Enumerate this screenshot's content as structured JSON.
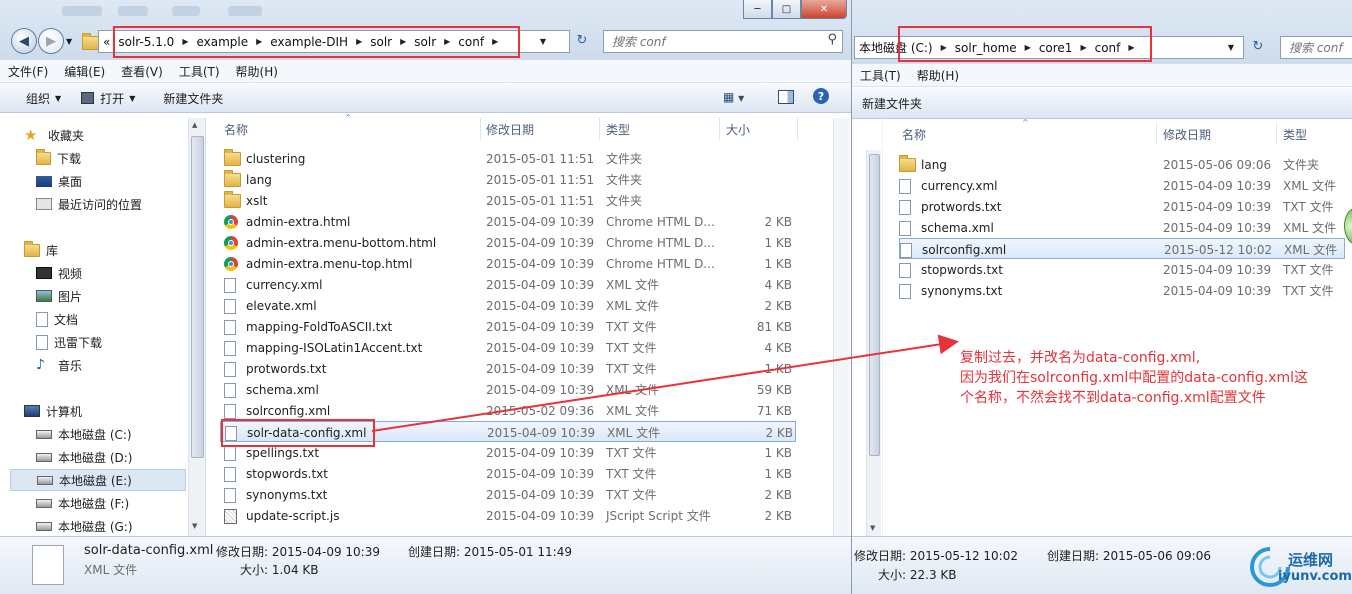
{
  "left": {
    "breadcrumbs": [
      "solr-5.1.0",
      "example",
      "example-DIH",
      "solr",
      "solr",
      "conf"
    ],
    "overflow_chevron": "«",
    "search_placeholder": "搜索 conf",
    "menu": [
      "文件(F)",
      "编辑(E)",
      "查看(V)",
      "工具(T)",
      "帮助(H)"
    ],
    "toolbar": {
      "organize": "组织",
      "open": "打开",
      "new_folder": "新建文件夹"
    },
    "nav": {
      "favorites": "收藏夹",
      "favorites_items": [
        "下载",
        "桌面",
        "最近访问的位置"
      ],
      "libraries": "库",
      "library_items": [
        "视频",
        "图片",
        "文档",
        "迅雷下载",
        "音乐"
      ],
      "computer": "计算机",
      "drives": [
        "本地磁盘 (C:)",
        "本地磁盘 (D:)",
        "本地磁盘 (E:)",
        "本地磁盘 (F:)",
        "本地磁盘 (G:)"
      ]
    },
    "columns": {
      "name": "名称",
      "date": "修改日期",
      "type": "类型",
      "size": "大小"
    },
    "files": [
      {
        "icon": "folder-icon",
        "name": "clustering",
        "date": "2015-05-01 11:51",
        "type": "文件夹",
        "size": ""
      },
      {
        "icon": "folder-icon",
        "name": "lang",
        "date": "2015-05-01 11:51",
        "type": "文件夹",
        "size": ""
      },
      {
        "icon": "folder-icon",
        "name": "xslt",
        "date": "2015-05-01 11:51",
        "type": "文件夹",
        "size": ""
      },
      {
        "icon": "chrome-html-icon",
        "name": "admin-extra.html",
        "date": "2015-04-09 10:39",
        "type": "Chrome HTML D...",
        "size": "2 KB"
      },
      {
        "icon": "chrome-html-icon",
        "name": "admin-extra.menu-bottom.html",
        "date": "2015-04-09 10:39",
        "type": "Chrome HTML D...",
        "size": "1 KB"
      },
      {
        "icon": "chrome-html-icon",
        "name": "admin-extra.menu-top.html",
        "date": "2015-04-09 10:39",
        "type": "Chrome HTML D...",
        "size": "1 KB"
      },
      {
        "icon": "document-icon",
        "name": "currency.xml",
        "date": "2015-04-09 10:39",
        "type": "XML 文件",
        "size": "4 KB"
      },
      {
        "icon": "document-icon",
        "name": "elevate.xml",
        "date": "2015-04-09 10:39",
        "type": "XML 文件",
        "size": "2 KB"
      },
      {
        "icon": "document-icon",
        "name": "mapping-FoldToASCII.txt",
        "date": "2015-04-09 10:39",
        "type": "TXT 文件",
        "size": "81 KB"
      },
      {
        "icon": "document-icon",
        "name": "mapping-ISOLatin1Accent.txt",
        "date": "2015-04-09 10:39",
        "type": "TXT 文件",
        "size": "4 KB"
      },
      {
        "icon": "document-icon",
        "name": "protwords.txt",
        "date": "2015-04-09 10:39",
        "type": "TXT 文件",
        "size": "1 KB"
      },
      {
        "icon": "document-icon",
        "name": "schema.xml",
        "date": "2015-04-09 10:39",
        "type": "XML 文件",
        "size": "59 KB"
      },
      {
        "icon": "document-icon",
        "name": "solrconfig.xml",
        "date": "2015-05-02 09:36",
        "type": "XML 文件",
        "size": "71 KB"
      },
      {
        "icon": "document-icon",
        "name": "solr-data-config.xml",
        "date": "2015-04-09 10:39",
        "type": "XML 文件",
        "size": "2 KB"
      },
      {
        "icon": "document-icon",
        "name": "spellings.txt",
        "date": "2015-04-09 10:39",
        "type": "TXT 文件",
        "size": "1 KB"
      },
      {
        "icon": "document-icon",
        "name": "stopwords.txt",
        "date": "2015-04-09 10:39",
        "type": "TXT 文件",
        "size": "1 KB"
      },
      {
        "icon": "document-icon",
        "name": "synonyms.txt",
        "date": "2015-04-09 10:39",
        "type": "TXT 文件",
        "size": "2 KB"
      },
      {
        "icon": "jscript-icon",
        "name": "update-script.js",
        "date": "2015-04-09 10:39",
        "type": "JScript Script 文件",
        "size": "2 KB"
      }
    ],
    "selected_index": 13,
    "details": {
      "filename": "solr-data-config.xml",
      "filetype": "XML 文件",
      "modified": "修改日期: 2015-04-09 10:39",
      "created": "创建日期: 2015-05-01 11:49",
      "size": "大小: 1.04 KB"
    }
  },
  "right": {
    "breadcrumbs": [
      "本地磁盘 (C:)",
      "solr_home",
      "core1",
      "conf"
    ],
    "search_placeholder": "搜索 conf",
    "menu": [
      "工具(T)",
      "帮助(H)"
    ],
    "toolbar": {
      "new_folder": "新建文件夹"
    },
    "columns": {
      "name": "名称",
      "date": "修改日期",
      "type": "类型"
    },
    "files": [
      {
        "icon": "folder-icon",
        "name": "lang",
        "date": "2015-05-06 09:06",
        "type": "文件夹"
      },
      {
        "icon": "document-icon",
        "name": "currency.xml",
        "date": "2015-04-09 10:39",
        "type": "XML 文件"
      },
      {
        "icon": "document-icon",
        "name": "protwords.txt",
        "date": "2015-04-09 10:39",
        "type": "TXT 文件"
      },
      {
        "icon": "document-icon",
        "name": "schema.xml",
        "date": "2015-04-09 10:39",
        "type": "XML 文件"
      },
      {
        "icon": "document-icon",
        "name": "solrconfig.xml",
        "date": "2015-05-12 10:02",
        "type": "XML 文件"
      },
      {
        "icon": "document-icon",
        "name": "stopwords.txt",
        "date": "2015-04-09 10:39",
        "type": "TXT 文件"
      },
      {
        "icon": "document-icon",
        "name": "synonyms.txt",
        "date": "2015-04-09 10:39",
        "type": "TXT 文件"
      }
    ],
    "selected_index": 4,
    "details": {
      "modified": "修改日期: 2015-05-12 10:02",
      "created": "创建日期: 2015-05-06 09:06",
      "size": "大小: 22.3 KB"
    }
  },
  "annotation": {
    "line1": "复制过去，并改名为data-config.xml,",
    "line2": "因为我们在solrconfig.xml中配置的data-config.xml这",
    "line3": "个名称，不然会找不到data-config.xml配置文件"
  },
  "watermark": {
    "cn": "运维网",
    "en": "iyunv.com"
  },
  "colors": {
    "highlight_red": "#e8323a",
    "selection": "#d9e8f9",
    "chrome_bar": "#dfe9f5"
  }
}
